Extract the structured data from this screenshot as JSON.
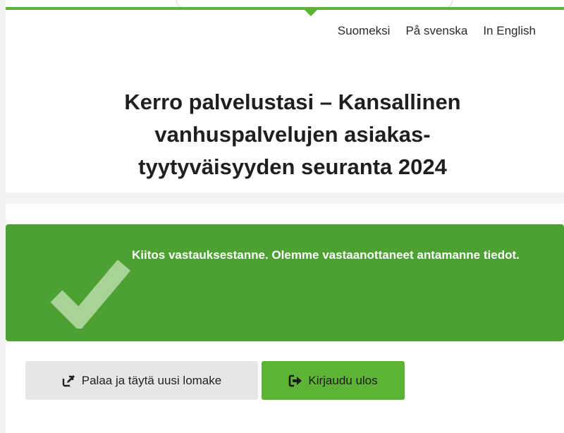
{
  "languages": {
    "finnish": "Suomeksi",
    "swedish": "På svenska",
    "english": "In English"
  },
  "page": {
    "title": "Kerro palvelustasi – Kansallinen\nvanhuspalvelujen asiakas-\ntyytyväisyyden seuranta 2024"
  },
  "alert": {
    "message": "Kiitos vastauksestanne. Olemme vastaanottaneet antamanne tiedot.",
    "icon": "checkmark-icon"
  },
  "actions": {
    "new_form_label": "Palaa ja täytä uusi lomake",
    "new_form_icon": "edit-icon",
    "logout_label": "Kirjaudu ulos",
    "logout_icon": "sign-out-icon"
  },
  "colors": {
    "brand_green": "#5cb335",
    "alert_green": "#4da132",
    "secondary_button": "#e6e6e6"
  }
}
